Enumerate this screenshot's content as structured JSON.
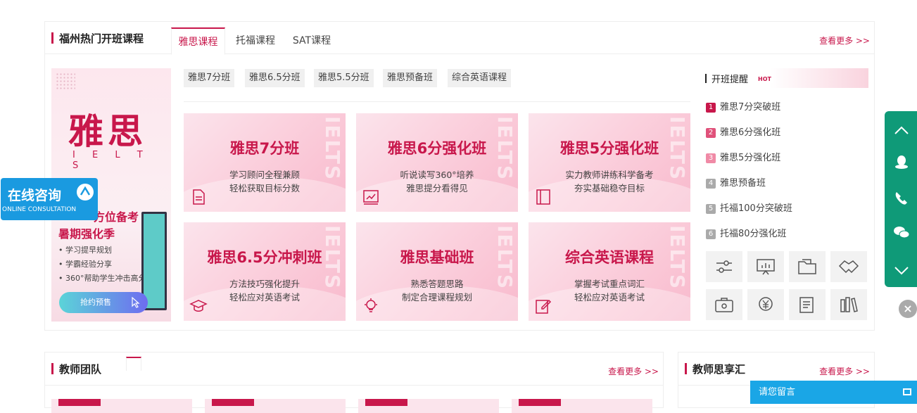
{
  "courses": {
    "title": "福州热门开班课程",
    "more": "查看更多 >>",
    "tabs": [
      {
        "label": "雅思课程"
      },
      {
        "label": "托福课程"
      },
      {
        "label": "SAT课程"
      }
    ],
    "subtags": [
      "雅思7分班",
      "雅思6.5分班",
      "雅思5.5分班",
      "雅思预备班",
      "综合英语课程"
    ],
    "promo": {
      "big": "雅思",
      "sub": "I E L T S",
      "line1": "方位备考",
      "line2": "暑期强化季",
      "bullets": [
        "• 学习提早规划",
        "• 学霸经验分享",
        "• 360°帮助学生冲击高分"
      ],
      "button": "抢约预售"
    },
    "cards": [
      {
        "title": "雅思7分班",
        "l1": "学习顾问全程兼顾",
        "l2": "轻松获取目标分数",
        "icon": "document-icon"
      },
      {
        "title": "雅思6分强化班",
        "l1": "听说读写360°培养",
        "l2": "雅思提分看得见",
        "icon": "chart-icon"
      },
      {
        "title": "雅思5分强化班",
        "l1": "实力教师讲练科学备考",
        "l2": "夯实基础稳夺目标",
        "icon": "book-icon"
      },
      {
        "title": "雅思6.5分冲刺班",
        "l1": "方法技巧强化提升",
        "l2": "轻松应对英语考试",
        "icon": "graduation-cap-icon"
      },
      {
        "title": "雅思基础班",
        "l1": "熟悉答题思路",
        "l2": "制定合理课程规划",
        "icon": "lightbulb-icon"
      },
      {
        "title": "综合英语课程",
        "l1": "掌握考试重点词汇",
        "l2": "轻松应对英语考试",
        "icon": "edit-icon"
      }
    ],
    "watermark": "IELTS",
    "reminder": {
      "title": "开班提醒",
      "hot": "HOT",
      "items": [
        {
          "num": "1",
          "label": "雅思7分突破班",
          "color": "#c8174b"
        },
        {
          "num": "2",
          "label": "雅思6分强化班",
          "color": "#e0517a"
        },
        {
          "num": "3",
          "label": "雅思5分强化班",
          "color": "#f08aa6"
        },
        {
          "num": "4",
          "label": "雅思预备班",
          "color": "#aaaaaa"
        },
        {
          "num": "5",
          "label": "托福100分突破班",
          "color": "#aaaaaa"
        },
        {
          "num": "6",
          "label": "托福80分强化班",
          "color": "#aaaaaa"
        }
      ]
    }
  },
  "consult": {
    "title": "在线咨询",
    "sub": "ONLINE CONSULTATION"
  },
  "teachers": {
    "title": "教师团队",
    "more": "查看更多 >>"
  },
  "share": {
    "title": "教师思享汇",
    "more": "查看更多 >>"
  },
  "message": {
    "label": "请您留言"
  },
  "colors": {
    "accent": "#c8174b",
    "side": "#0f9a78",
    "consult": "#1a9ae0"
  }
}
